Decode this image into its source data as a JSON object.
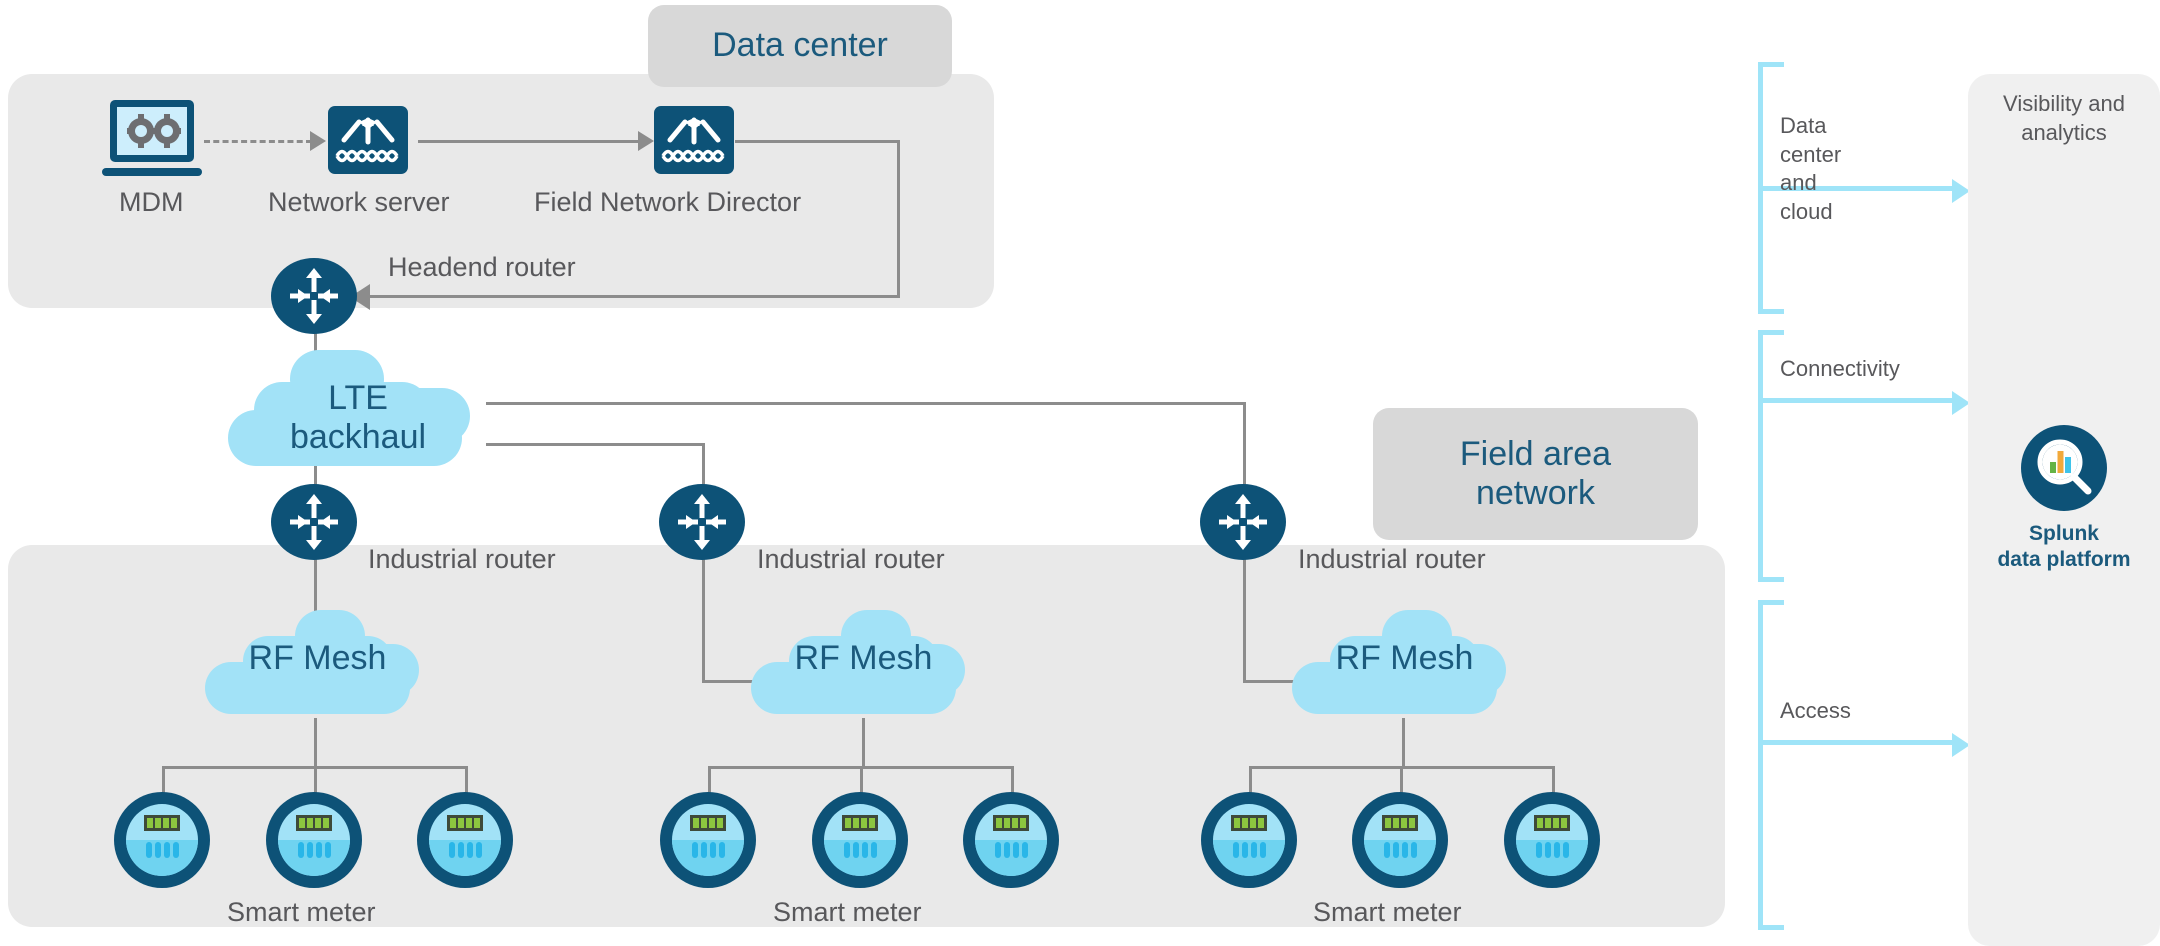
{
  "zones": {
    "data_center": {
      "title": "Data center"
    },
    "field_area_network": {
      "title": "Field area\nnetwork"
    }
  },
  "data_center_nodes": [
    {
      "id": "mdm",
      "label": "MDM",
      "icon": "laptop-gears-icon"
    },
    {
      "id": "nserv",
      "label": "Network server",
      "icon": "network-switch-icon"
    },
    {
      "id": "fnd",
      "label": "Field Network Director",
      "icon": "network-switch-icon"
    },
    {
      "id": "hrtr",
      "label": "Headend router",
      "icon": "router-icon"
    }
  ],
  "backhaul": {
    "label": "LTE\nbackhaul",
    "icon": "cloud-icon"
  },
  "access_groups": [
    {
      "router_label": "Industrial router",
      "router_icon": "router-icon",
      "mesh_label": "RF Mesh",
      "mesh_icon": "cloud-icon",
      "meter_label": "Smart meter",
      "meter_icon": "smart-meter-icon",
      "meter_count": 3
    },
    {
      "router_label": "Industrial router",
      "router_icon": "router-icon",
      "mesh_label": "RF Mesh",
      "mesh_icon": "cloud-icon",
      "meter_label": "Smart meter",
      "meter_icon": "smart-meter-icon",
      "meter_count": 3
    },
    {
      "router_label": "Industrial router",
      "router_icon": "router-icon",
      "mesh_label": "RF Mesh",
      "mesh_icon": "cloud-icon",
      "meter_label": "Smart meter",
      "meter_icon": "smart-meter-icon",
      "meter_count": 3
    }
  ],
  "layer_brackets": [
    {
      "id": "data-center-and-cloud",
      "label": "Data center\nand cloud"
    },
    {
      "id": "connectivity",
      "label": "Connectivity"
    },
    {
      "id": "access",
      "label": "Access"
    }
  ],
  "analytics_panel": {
    "title": "Visibility and\nanalytics",
    "product": {
      "name": "Splunk\ndata platform",
      "icon": "splunk-search-icon"
    }
  },
  "colors": {
    "brand_dark_blue": "#0d5277",
    "teal_text": "#1b5a7d",
    "cloud_blue": "#a2e2f7",
    "bracket_cyan": "#9fe4f8",
    "panel_gray": "#e9e9e9",
    "chip_gray": "#d8d8d8",
    "vis_panel_gray": "#f0f0f0",
    "label_gray": "#58585b",
    "line_gray": "#8c8c8c",
    "meter_led_green": "#8cc63f",
    "meter_bar_cyan": "#29b6e8",
    "splunk_bar_green": "#65b345",
    "splunk_bar_orange": "#f2a93b",
    "splunk_bar_cyan": "#3fc3ea"
  }
}
